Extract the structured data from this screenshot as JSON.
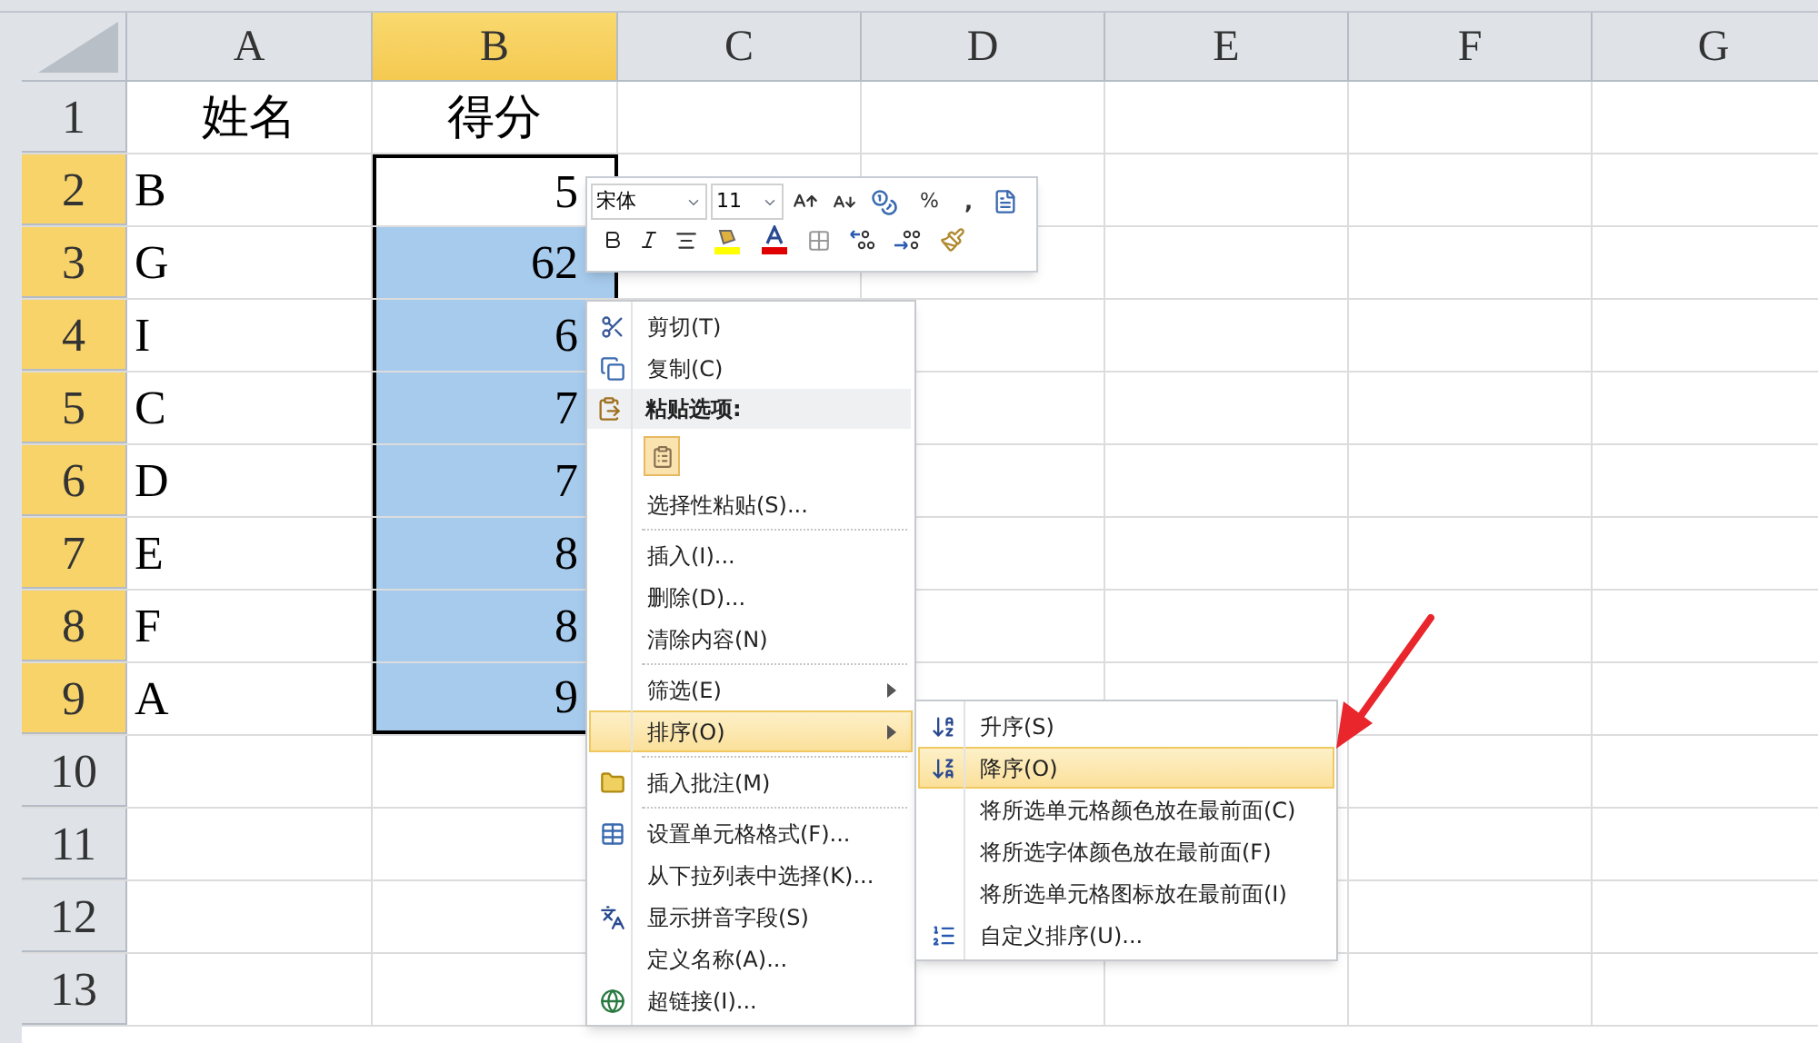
{
  "columns": [
    {
      "label": "A",
      "selected": false
    },
    {
      "label": "B",
      "selected": true
    },
    {
      "label": "C",
      "selected": false
    },
    {
      "label": "D",
      "selected": false
    },
    {
      "label": "E",
      "selected": false
    },
    {
      "label": "F",
      "selected": false
    },
    {
      "label": "G",
      "selected": false
    }
  ],
  "rows": [
    {
      "number": "1",
      "selected": false,
      "cells": [
        {
          "text": "姓名",
          "selected": false
        },
        {
          "text": "得分",
          "selected": false
        }
      ]
    },
    {
      "number": "2",
      "selected": true,
      "cells": [
        {
          "text": "B",
          "selected": false
        },
        {
          "text": "5",
          "selected": false
        }
      ]
    },
    {
      "number": "3",
      "selected": true,
      "cells": [
        {
          "text": "G",
          "selected": false
        },
        {
          "text": "62",
          "selected": true
        }
      ]
    },
    {
      "number": "4",
      "selected": true,
      "cells": [
        {
          "text": "I",
          "selected": false
        },
        {
          "text": "6",
          "selected": true
        }
      ]
    },
    {
      "number": "5",
      "selected": true,
      "cells": [
        {
          "text": "C",
          "selected": false
        },
        {
          "text": "7",
          "selected": true
        }
      ]
    },
    {
      "number": "6",
      "selected": true,
      "cells": [
        {
          "text": "D",
          "selected": false
        },
        {
          "text": "7",
          "selected": true
        }
      ]
    },
    {
      "number": "7",
      "selected": true,
      "cells": [
        {
          "text": "E",
          "selected": false
        },
        {
          "text": "8",
          "selected": true
        }
      ]
    },
    {
      "number": "8",
      "selected": true,
      "cells": [
        {
          "text": "F",
          "selected": false
        },
        {
          "text": "8",
          "selected": true
        }
      ]
    },
    {
      "number": "9",
      "selected": true,
      "cells": [
        {
          "text": "A",
          "selected": false
        },
        {
          "text": "9",
          "selected": true
        }
      ]
    },
    {
      "number": "10",
      "selected": false
    },
    {
      "number": "11",
      "selected": false
    },
    {
      "number": "12",
      "selected": false
    },
    {
      "number": "13",
      "selected": false
    }
  ],
  "mini_toolbar": {
    "font": "宋体",
    "size": "11",
    "percent": "%",
    "comma": ","
  },
  "context_menu": {
    "items": [
      {
        "kind": "item",
        "label": "剪切(T)",
        "selected": false
      },
      {
        "kind": "item",
        "label": "复制(C)",
        "selected": false
      },
      {
        "kind": "header",
        "label": "粘贴选项:"
      },
      {
        "kind": "paste"
      },
      {
        "kind": "item",
        "label": "选择性粘贴(S)...",
        "selected": false
      },
      {
        "kind": "separator"
      },
      {
        "kind": "item",
        "label": "插入(I)...",
        "selected": false
      },
      {
        "kind": "item",
        "label": "删除(D)...",
        "selected": false
      },
      {
        "kind": "item",
        "label": "清除内容(N)",
        "selected": false
      },
      {
        "kind": "separator"
      },
      {
        "kind": "item",
        "label": "筛选(E)",
        "submenu": true,
        "selected": false
      },
      {
        "kind": "item",
        "label": "排序(O)",
        "submenu": true,
        "selected": true
      },
      {
        "kind": "separator"
      },
      {
        "kind": "item",
        "label": "插入批注(M)",
        "selected": false
      },
      {
        "kind": "separator"
      },
      {
        "kind": "item",
        "label": "设置单元格格式(F)...",
        "selected": false
      },
      {
        "kind": "item",
        "label": "从下拉列表中选择(K)...",
        "selected": false
      },
      {
        "kind": "item",
        "label": "显示拼音字段(S)",
        "selected": false
      },
      {
        "kind": "item",
        "label": "定义名称(A)...",
        "selected": false
      },
      {
        "kind": "item",
        "label": "超链接(I)...",
        "selected": false
      }
    ]
  },
  "submenu": {
    "items": [
      {
        "label": "升序(S)",
        "selected": false
      },
      {
        "label": "降序(O)",
        "selected": true
      },
      {
        "label": "将所选单元格颜色放在最前面(C)",
        "selected": false
      },
      {
        "label": "将所选字体颜色放在最前面(F)",
        "selected": false
      },
      {
        "label": "将所选单元格图标放在最前面(I)",
        "selected": false
      },
      {
        "label": "自定义排序(U)...",
        "selected": false
      }
    ]
  }
}
